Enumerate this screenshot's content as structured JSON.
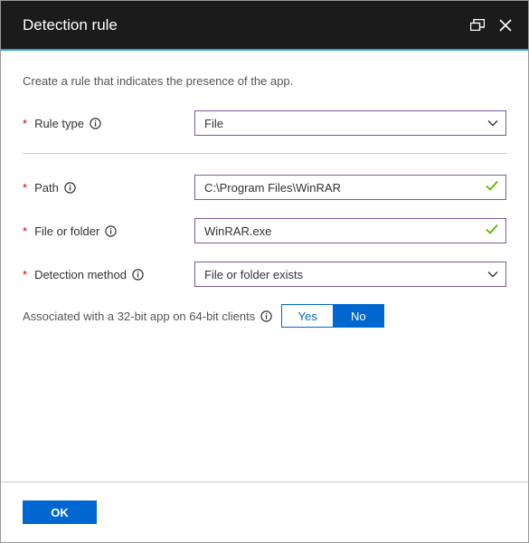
{
  "header": {
    "title": "Detection rule"
  },
  "intro": "Create a rule that indicates the presence of the app.",
  "fields": {
    "rule_type": {
      "label": "Rule type",
      "value": "File"
    },
    "path": {
      "label": "Path",
      "value": "C:\\Program Files\\WinRAR"
    },
    "file_or_folder": {
      "label": "File or folder",
      "value": "WinRAR.exe"
    },
    "detection_method": {
      "label": "Detection method",
      "value": "File or folder exists"
    }
  },
  "assoc": {
    "label": "Associated with a 32-bit app on 64-bit clients",
    "options": {
      "yes": "Yes",
      "no": "No"
    },
    "selected": "no"
  },
  "footer": {
    "ok": "OK"
  },
  "required_marker": "*"
}
